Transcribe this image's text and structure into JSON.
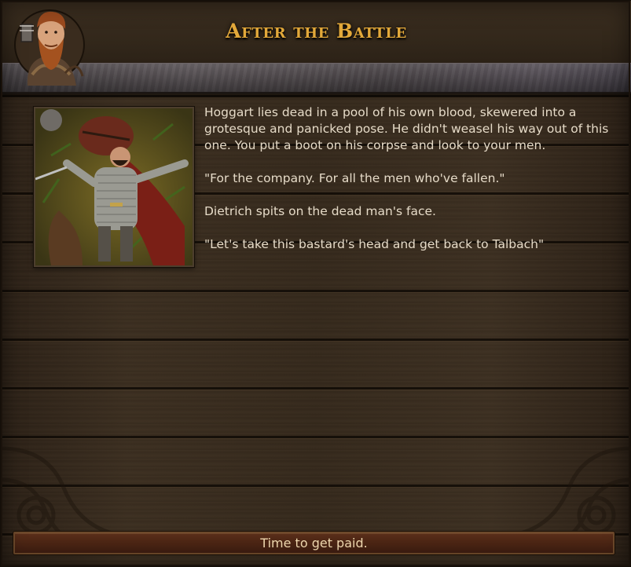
{
  "header": {
    "title": "After the Battle",
    "portrait_icon": "bearded-mercenary-portrait-icon"
  },
  "event": {
    "image_icon": "fallen-knight-illustration",
    "paragraphs": [
      "Hoggart lies dead in a pool of his own blood, skewered into a grotesque and panicked pose. He didn't weasel his way out of this one. You put a boot on his corpse and look to your men.",
      "\"For the company. For all the men who've fallen.\"",
      "Dietrich spits on the dead man's face.",
      "\"Let's take this bastard's head and get back to Talbach\""
    ]
  },
  "actions": {
    "continue_label": "Time to get paid."
  },
  "colors": {
    "title": "#e3a93a",
    "text": "#e6dbc8",
    "button": "#4b2514"
  }
}
